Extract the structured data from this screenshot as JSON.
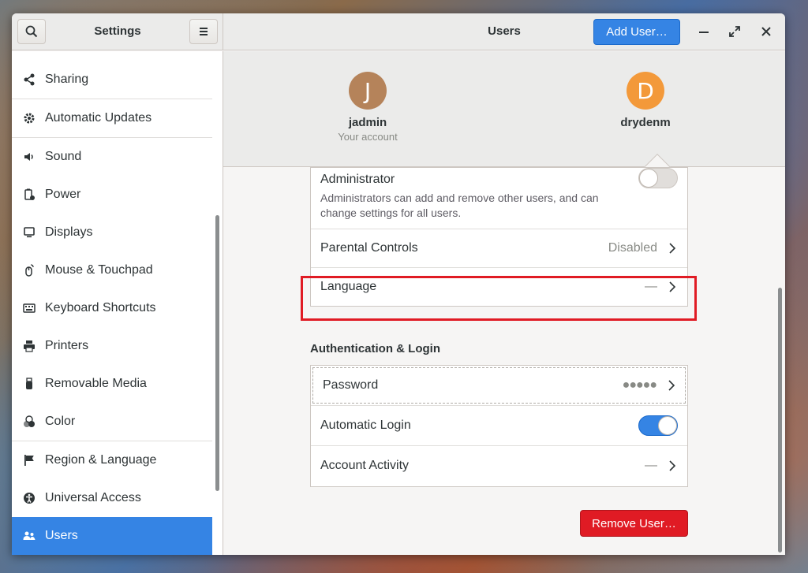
{
  "window": {
    "sidebar_title": "Settings",
    "main_title": "Users",
    "add_user_label": "Add User…"
  },
  "sidebar": {
    "items": [
      {
        "label": "Sharing",
        "icon": "share-icon"
      },
      {
        "label": "Automatic Updates",
        "icon": "gear-icon"
      },
      {
        "label": "Sound",
        "icon": "speaker-icon"
      },
      {
        "label": "Power",
        "icon": "battery-icon"
      },
      {
        "label": "Displays",
        "icon": "monitor-icon"
      },
      {
        "label": "Mouse & Touchpad",
        "icon": "mouse-icon"
      },
      {
        "label": "Keyboard Shortcuts",
        "icon": "keyboard-icon"
      },
      {
        "label": "Printers",
        "icon": "printer-icon"
      },
      {
        "label": "Removable Media",
        "icon": "usb-icon"
      },
      {
        "label": "Color",
        "icon": "color-icon"
      },
      {
        "label": "Region & Language",
        "icon": "flag-icon"
      },
      {
        "label": "Universal Access",
        "icon": "accessibility-icon"
      },
      {
        "label": "Users",
        "icon": "users-icon"
      }
    ],
    "selected": "Users"
  },
  "users": [
    {
      "initial": "J",
      "name": "jadmin",
      "subtitle": "Your account",
      "color": "#b5835a"
    },
    {
      "initial": "D",
      "name": "drydenm",
      "subtitle": "",
      "color": "#f3993a"
    }
  ],
  "account_settings": {
    "administrator_label": "Administrator",
    "administrator_desc_line1": "Administrators can add and remove other users, and can",
    "administrator_desc_line2": "change settings for all users.",
    "administrator_enabled": false,
    "parental_controls_label": "Parental Controls",
    "parental_controls_value": "Disabled",
    "language_label": "Language",
    "language_value": "—"
  },
  "auth": {
    "section_title": "Authentication & Login",
    "password_label": "Password",
    "password_value": "●●●●●",
    "automatic_login_label": "Automatic Login",
    "automatic_login_enabled": true,
    "account_activity_label": "Account Activity",
    "account_activity_value": "—"
  },
  "remove_user_label": "Remove User…",
  "colors": {
    "accent": "#3584e4",
    "destructive": "#e01b24",
    "highlight": "#e01b24"
  }
}
